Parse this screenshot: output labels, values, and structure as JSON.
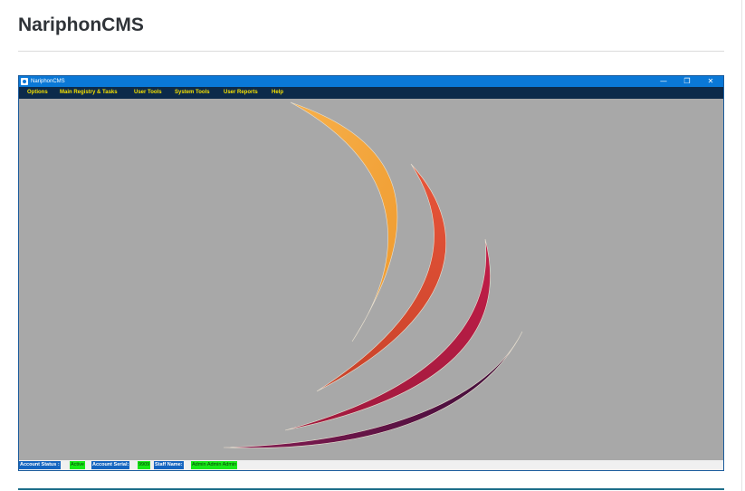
{
  "page": {
    "title": "NariphonCMS"
  },
  "window": {
    "title": "NariphonCMS",
    "controls": {
      "minimize": "—",
      "restore": "❐",
      "close": "✕"
    }
  },
  "menu": {
    "items": [
      {
        "label": "Options"
      },
      {
        "label": "Main Registry & Tasks"
      },
      {
        "label": "User Tools"
      },
      {
        "label": "System Tools"
      },
      {
        "label": "User Reports"
      },
      {
        "label": "Help"
      }
    ]
  },
  "status": {
    "account_status_label": "Account Status :",
    "account_status_value": "Active",
    "account_serial_label": "Account Serial:",
    "account_serial_value": "9909",
    "staff_name_label": "Staff Name:",
    "staff_name_value": "Admin Admin Admin"
  },
  "colors": {
    "titlebar": "#0a78d7",
    "menubar": "#0c2a4a",
    "menu_text": "#f5e000",
    "canvas": "#a8a8a8",
    "status_label_bg": "#1565c0",
    "status_value_bg": "#17e817",
    "logo_orange": "#f5a83c",
    "logo_red": "#d8402f",
    "logo_crimson": "#b51a45",
    "logo_plum": "#5a1448"
  },
  "icons": {
    "app": "app-window-icon"
  }
}
